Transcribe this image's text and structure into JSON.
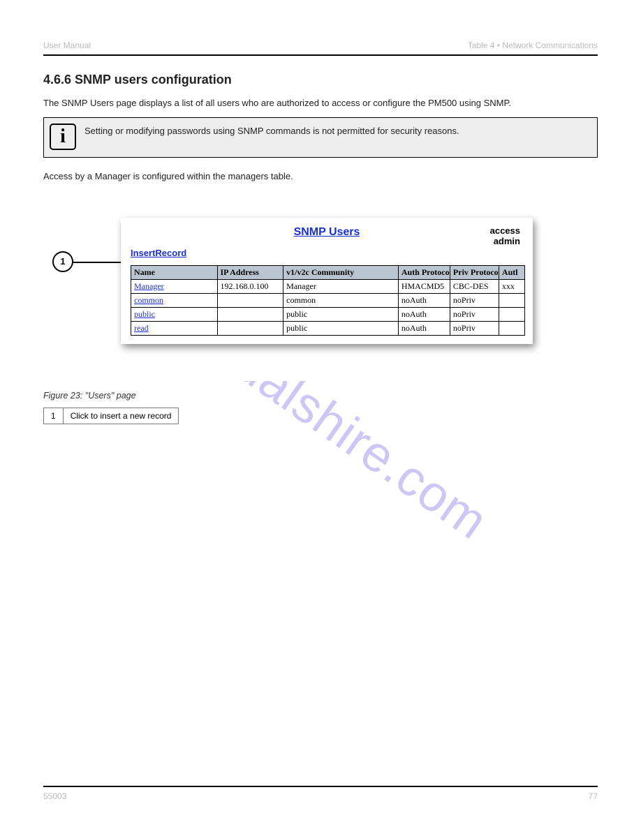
{
  "header": {
    "left_gray": "User Manual",
    "right_gray": "Table 4 • Network Communications"
  },
  "section": {
    "title": "4.6.6 SNMP users configuration",
    "intro": "The SNMP Users page displays a list of all users who are authorized to access or configure the PM500 using SNMP."
  },
  "note": {
    "icon": "i",
    "text": "Setting or modifying passwords using SNMP commands is not permitted for security reasons."
  },
  "manager_sentence": "Access by a Manager is configured within the managers table.",
  "figure": {
    "screenshot": {
      "title": "SNMP Users",
      "access_label_line1": "access",
      "access_label_line2": "admin",
      "insert_label": "InsertRecord",
      "columns": {
        "name": "Name",
        "ip": "IP Address",
        "community": "v1/v2c Community",
        "auth_proto": "Auth Protocol",
        "priv_proto": "Priv Protocol",
        "authk": "Autl"
      },
      "rows": [
        {
          "name": "Manager",
          "ip": "192.168.0.100",
          "community": "Manager",
          "auth": "HMACMD5",
          "priv": "CBC-DES",
          "authk": "xxx"
        },
        {
          "name": "common",
          "ip": "",
          "community": "common",
          "auth": "noAuth",
          "priv": "noPriv",
          "authk": ""
        },
        {
          "name": "public",
          "ip": "",
          "community": "public",
          "auth": "noAuth",
          "priv": "noPriv",
          "authk": ""
        },
        {
          "name": "read",
          "ip": "",
          "community": "public",
          "auth": "noAuth",
          "priv": "noPriv",
          "authk": ""
        }
      ]
    },
    "callout_number": "1",
    "caption": "Figure 23: \"Users\" page",
    "callouts": [
      {
        "num": "1",
        "text": "Click to insert a new record"
      }
    ]
  },
  "watermark": "manualshire.com",
  "footer": {
    "left_gray": "55003",
    "right_gray": "77"
  }
}
